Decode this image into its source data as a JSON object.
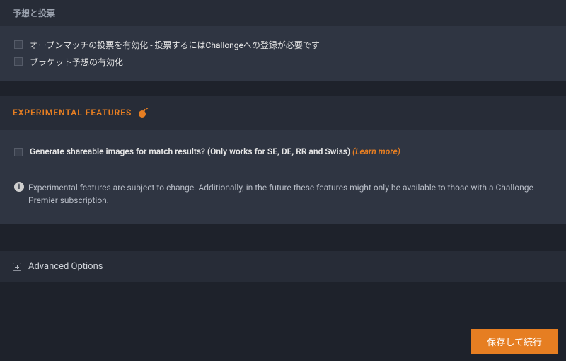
{
  "sections": {
    "voting": {
      "title": "予想と投票",
      "options": [
        {
          "label": "オープンマッチの投票を有効化 - 投票するにはChallongeへの登録が必要です"
        },
        {
          "label": "ブラケット予想の有効化"
        }
      ]
    },
    "experimental": {
      "title": "Experimental Features",
      "option_label": "Generate shareable images for match results? (Only works for SE, DE, RR and Swiss)",
      "learn_more": "(Learn more)",
      "info": "Experimental features are subject to change. Additionally, in the future these features might only be available to those with a Challonge Premier subscription."
    },
    "advanced": {
      "label": "Advanced Options"
    }
  },
  "footer": {
    "save_label": "保存して続行"
  },
  "colors": {
    "accent": "#e67e22",
    "panel": "#2f3542",
    "panel_header": "#272c37",
    "bg": "#1e222b"
  }
}
